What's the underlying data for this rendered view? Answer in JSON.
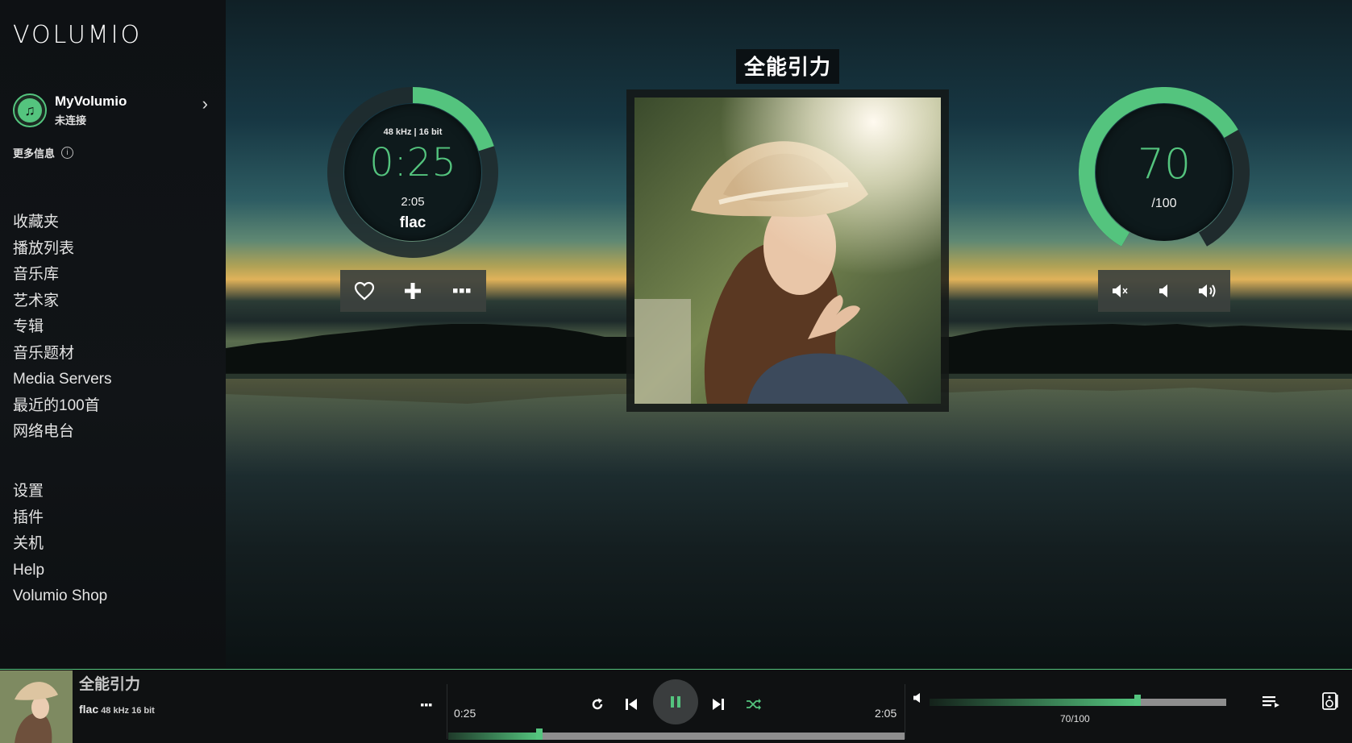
{
  "brand": {
    "logo": "VOLUMIO",
    "accent": "#54c47e"
  },
  "sidebar": {
    "account": {
      "title": "MyVolumio",
      "status": "未连接"
    },
    "more_info": "更多信息",
    "menu_primary": [
      "收藏夹",
      "播放列表",
      "音乐库",
      "艺术家",
      "专辑",
      "音乐题材",
      "Media Servers",
      "最近的100首",
      "网络电台"
    ],
    "menu_secondary": [
      "设置",
      "插件",
      "关机",
      "Help",
      "Volumio Shop"
    ]
  },
  "now_playing": {
    "title": "全能引力",
    "format_info": "48 kHz | 16 bit",
    "elapsed": "0:25",
    "duration": "2:05",
    "codec": "flac",
    "progress": 0.2
  },
  "volume": {
    "value": "70",
    "max_label": "/100",
    "level": 0.7
  },
  "player_bar": {
    "title": "全能引力",
    "codec": "flac",
    "format_info": "48 kHz 16 bit",
    "elapsed": "0:25",
    "duration": "2:05",
    "volume_label": "70/100"
  }
}
